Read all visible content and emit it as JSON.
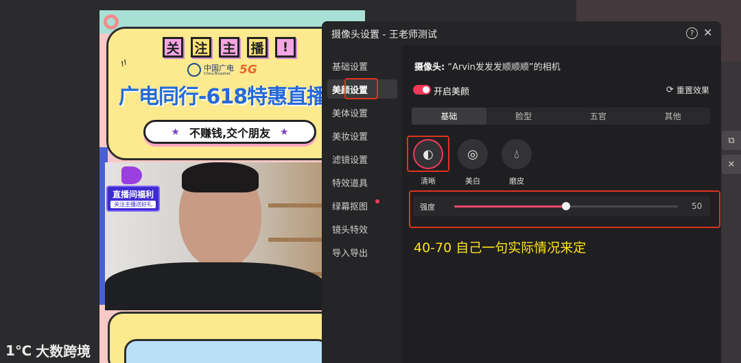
{
  "colors": {
    "accent": "#f33b5c",
    "annotation_red": "#e0321f",
    "note_yellow": "#ffe21c",
    "dialog_bg": "#1f1f21"
  },
  "poster": {
    "follow_chars": [
      "关",
      "注",
      "主",
      "播",
      "!"
    ],
    "brand_cn": "中国广电",
    "brand_en": "China Broadnet",
    "brand_5g": "5G",
    "headline": "广电同行-618特惠直播",
    "slogan": "不赚钱,交个朋友",
    "badge_title": "直播间福利",
    "badge_sub": "关注主播送好礼"
  },
  "watermark": {
    "logo": "1℃",
    "text": "大数跨境"
  },
  "side_icons": [
    "copy-icon",
    "close-icon"
  ],
  "dialog": {
    "title": "摄像头设置 - 王老师测试",
    "help": "?",
    "close": "✕",
    "nav": [
      {
        "label": "基础设置"
      },
      {
        "label": "美颜设置",
        "active": true
      },
      {
        "label": "美体设置"
      },
      {
        "label": "美妆设置"
      },
      {
        "label": "滤镜设置"
      },
      {
        "label": "特效道具"
      },
      {
        "label": "绿幕抠图",
        "dot": true
      },
      {
        "label": "镜头特效"
      },
      {
        "label": "导入导出"
      }
    ],
    "camera_prefix": "摄像头:",
    "camera_name": "“Arvin发发发顺顺顺”的相机",
    "beauty_toggle": {
      "label": "开启美颜",
      "on": true
    },
    "reset_label": "重置效果",
    "tabs": [
      {
        "label": "基础",
        "active": true
      },
      {
        "label": "脸型"
      },
      {
        "label": "五官"
      },
      {
        "label": "其他"
      }
    ],
    "effects": [
      {
        "label": "清晰",
        "icon": "clarity-icon",
        "selected": true
      },
      {
        "label": "美白",
        "icon": "whitening-icon"
      },
      {
        "label": "磨皮",
        "icon": "smoothing-icon"
      }
    ],
    "slider": {
      "label": "强度",
      "value": 50,
      "max": 100
    },
    "note": "40-70 自己一句实际情况来定"
  }
}
